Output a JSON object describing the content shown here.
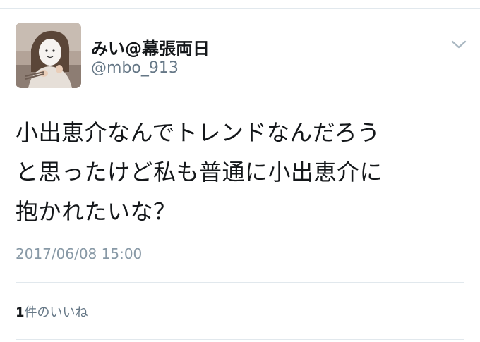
{
  "user": {
    "display_name": "みい@幕張両日",
    "handle": "@mbo_913",
    "avatar_icon": "user-avatar-photo"
  },
  "menu": {
    "icon": "chevron-down-icon",
    "color": "#aab8c2"
  },
  "tweet": {
    "lines": [
      "小出恵介なんでトレンドなんだろう",
      "と思ったけど私も普通に小出恵介に",
      "抱かれたいな？"
    ],
    "timestamp": "2017/06/08 15:00"
  },
  "stats": {
    "likes_count": "1",
    "likes_label": "件のいいね"
  },
  "colors": {
    "text_primary": "#14171a",
    "text_secondary": "#657786",
    "divider": "#e1e8ed"
  }
}
